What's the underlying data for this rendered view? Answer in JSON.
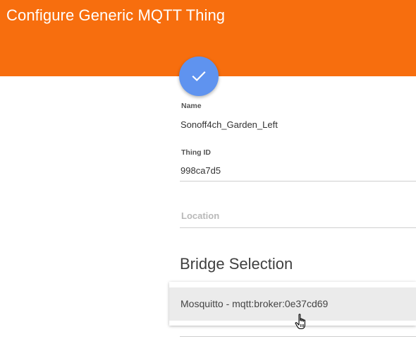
{
  "header": {
    "title": "Configure Generic MQTT Thing",
    "background_color": "#f76e0e"
  },
  "save_fab": {
    "icon": "check-icon",
    "color": "#5f93ef"
  },
  "form": {
    "name": {
      "label": "Name",
      "value": "Sonoff4ch_Garden_Left"
    },
    "thing_id": {
      "label": "Thing ID",
      "value": "998ca7d5"
    },
    "location": {
      "placeholder": "Location",
      "value": ""
    }
  },
  "bridge_selection": {
    "title": "Bridge Selection",
    "options": [
      {
        "label": "Mosquitto - mqtt:broker:0e37cd69",
        "highlighted": true
      }
    ]
  },
  "cursor": {
    "icon": "hand-pointer-icon"
  }
}
